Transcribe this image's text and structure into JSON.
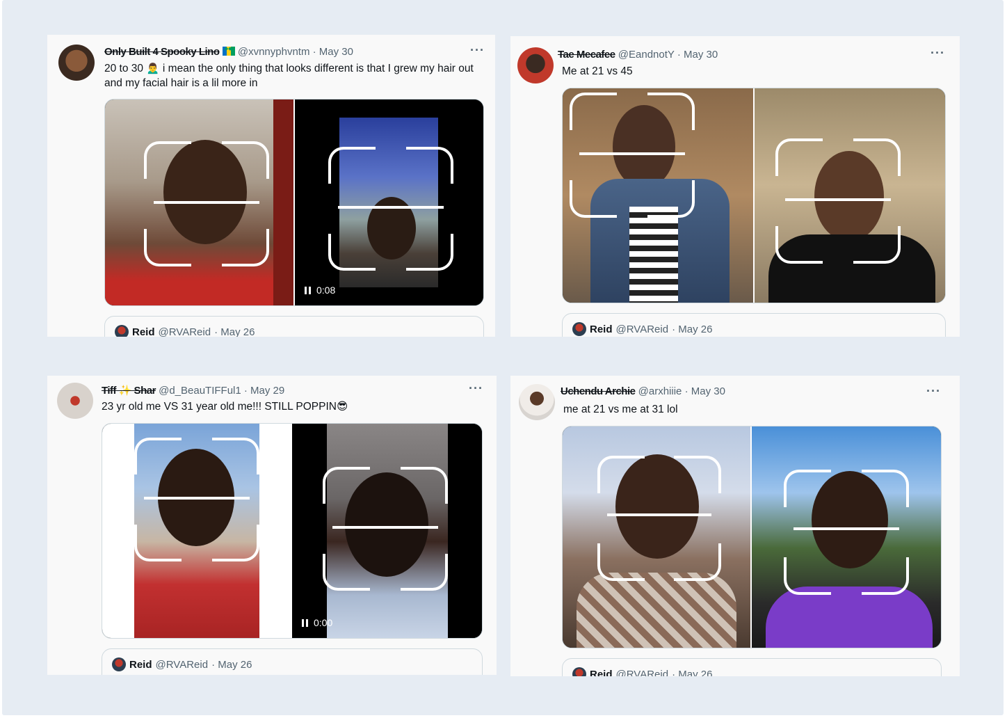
{
  "tweets": [
    {
      "display_name": "Only Built 4 Spooky Lino",
      "flag_icon": "saint-vincent-flag-icon",
      "handle": "@xvnnyphvntm",
      "date": "· May 30",
      "more": "···",
      "text": "20 to 30 🙍‍♂️ i mean the only thing that looks different is that I grew my hair out and my facial hair is a lil more in",
      "video_time": "0:08",
      "quote": {
        "name": "Reid",
        "handle": "@RVAReid",
        "date": "· May 26"
      }
    },
    {
      "display_name": "Tae Mecafee",
      "handle": "@EandnotY",
      "date": "· May 30",
      "more": "···",
      "text": "Me at 21 vs 45",
      "quote": {
        "name": "Reid",
        "handle": "@RVAReid",
        "date": "· May 26"
      }
    },
    {
      "display_name": "Tiff ✨ Shar",
      "handle": "@d_BeauTIFFul1",
      "date": "· May 29",
      "more": "···",
      "text": "23 yr old me VS 31 year old me!!! STILL POPPIN😎",
      "video_time": "0:00",
      "quote": {
        "name": "Reid",
        "handle": "@RVAReid",
        "date": "· May 26"
      }
    },
    {
      "display_name": "Uchendu Archie",
      "handle": "@arxhiiie",
      "date": "· May 30",
      "more": "···",
      "text": "me at 21 vs me at 31 lol",
      "quote": {
        "name": "Reid",
        "handle": "@RVAReid",
        "date": "· May 26"
      }
    }
  ]
}
